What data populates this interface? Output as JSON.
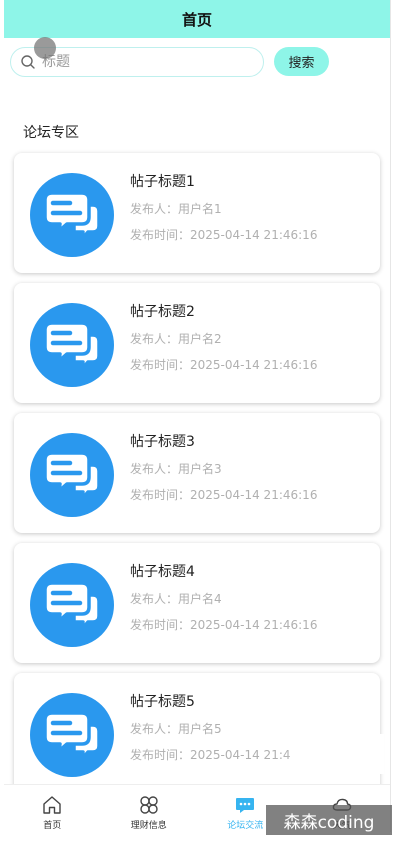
{
  "header": {
    "title": "首页"
  },
  "search": {
    "placeholder": "标题",
    "value": "",
    "button_label": "搜索"
  },
  "section": {
    "title": "论坛专区"
  },
  "posts": [
    {
      "title": "帖子标题1",
      "author": "发布人：用户名1",
      "time": "发布时间：2025-04-14 21:46:16"
    },
    {
      "title": "帖子标题2",
      "author": "发布人：用户名2",
      "time": "发布时间：2025-04-14 21:46:16"
    },
    {
      "title": "帖子标题3",
      "author": "发布人：用户名3",
      "time": "发布时间：2025-04-14 21:46:16"
    },
    {
      "title": "帖子标题4",
      "author": "发布人：用户名4",
      "time": "发布时间：2025-04-14 21:46:16"
    },
    {
      "title": "帖子标题5",
      "author": "发布人：用户名5",
      "time": "发布时间：2025-04-14 21:4"
    }
  ],
  "tabbar": {
    "items": [
      {
        "label": "首页",
        "icon": "home-icon"
      },
      {
        "label": "理财信息",
        "icon": "grid-icon"
      },
      {
        "label": "论坛交流",
        "icon": "chat-icon",
        "active": true
      },
      {
        "label": "天气",
        "icon": "cloud-icon"
      }
    ]
  },
  "watermark": {
    "text": "森森coding"
  },
  "colors": {
    "header_bg": "#8ef5e8",
    "accent": "#2a98ee",
    "active_tab": "#36b4f0"
  }
}
